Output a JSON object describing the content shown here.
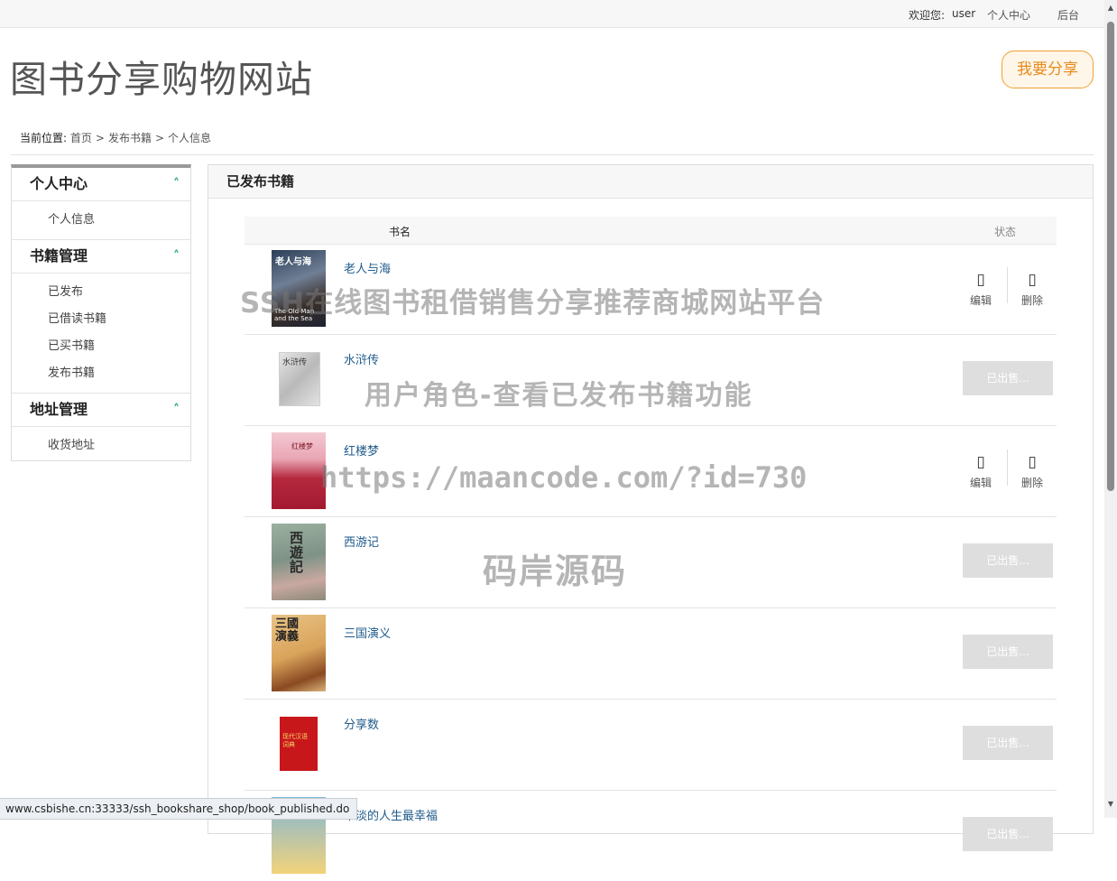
{
  "topbar": {
    "welcome": "欢迎您:",
    "user": "user",
    "personal_center": "个人中心",
    "admin": "后台"
  },
  "header": {
    "site_title": "图书分享购物网站",
    "share_button": "我要分享"
  },
  "breadcrumb": {
    "label": "当前位置:",
    "items": [
      "首页",
      "发布书籍",
      "个人信息"
    ]
  },
  "sidebar": {
    "groups": [
      {
        "title": "个人中心",
        "items": [
          "个人信息"
        ]
      },
      {
        "title": "书籍管理",
        "items": [
          "已发布",
          "已借读书籍",
          "已买书籍",
          "发布书籍"
        ]
      },
      {
        "title": "地址管理",
        "items": [
          "收货地址"
        ]
      }
    ]
  },
  "panel": {
    "title": "已发布书籍",
    "col_name": "书名",
    "col_status": "状态",
    "edit_label": "编辑",
    "delete_label": "删除",
    "sold_label": "已出售...",
    "rows": [
      {
        "title": "老人与海",
        "status": "actions"
      },
      {
        "title": "水浒传",
        "status": "sold"
      },
      {
        "title": "红楼梦",
        "status": "actions"
      },
      {
        "title": "西游记",
        "status": "sold"
      },
      {
        "title": "三国演义",
        "status": "sold"
      },
      {
        "title": "分享数",
        "status": "sold"
      },
      {
        "title": "平淡的人生最幸福",
        "status": "sold"
      }
    ]
  },
  "watermark": {
    "line1": "SSH在线图书租借销售分享推荐商城网站平台",
    "line2": "用户角色-查看已发布书籍功能",
    "line3": "https://maancode.com/?id=730",
    "line4": "码岸源码"
  },
  "statusbar": {
    "url": "www.csbishe.cn:33333/ssh_bookshare_shop/book_published.do"
  },
  "colors": {
    "accent_orange": "#e88a1a",
    "link_blue": "#1f5b8c",
    "chevron_teal": "#1aa08a"
  }
}
